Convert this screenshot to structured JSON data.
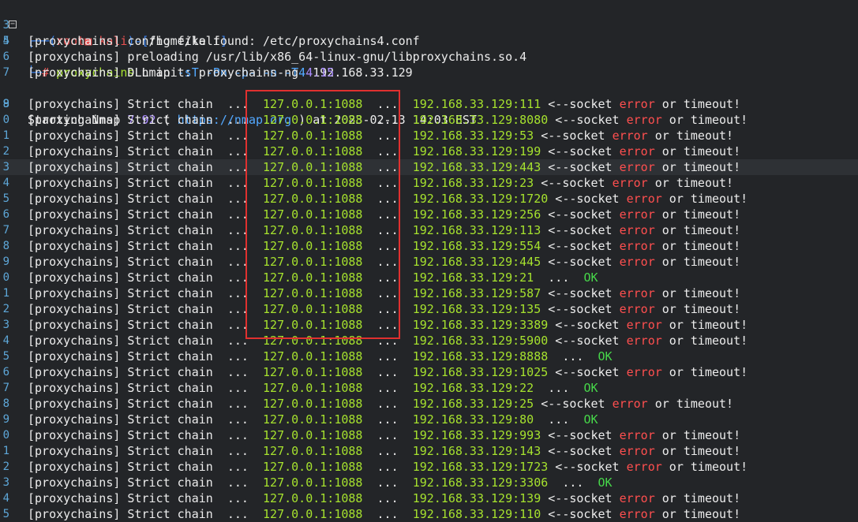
{
  "prompt": {
    "line_number": "3",
    "user": "root",
    "host": "kali",
    "skull": "■",
    "cwd": "/home/kali",
    "command_line_number": "4",
    "command": "proxychains",
    "cmd_args": "nmap",
    "flags": "-sT -Pn -p- -n -T4",
    "target": "192.168.33.129"
  },
  "header_lines": [
    {
      "n": "5",
      "prefix": "[proxychains]",
      "text": " config file found: /etc/proxychains4.conf"
    },
    {
      "n": "6",
      "prefix": "[proxychains]",
      "text": " preloading /usr/lib/x86_64-linux-gnu/libproxychains.so.4"
    },
    {
      "n": "7",
      "prefix": "[proxychains]",
      "text": " DLL init: proxychains-ng ",
      "version": "4.15"
    }
  ],
  "nmap_start": {
    "n": "8",
    "label": "Starting Nmap ",
    "version": "7.92",
    "paren_open": " ( ",
    "url": "https://nmap.org",
    "paren_close": " ) at ",
    "time": "2023-02-13 14:03 EST"
  },
  "chain": {
    "prefix": "[proxychains]",
    "mode": " Strict chain  ...  ",
    "proxy": "127.0.0.1:1088",
    "sep": "  ...  ",
    "sock": " <--socket ",
    "err": "error",
    "or": " or timeout!",
    "ok_sep": "  ...  ",
    "ok": "OK"
  },
  "chain_lines": [
    {
      "n": "9",
      "port": "192.168.33.129:111",
      "status": "error"
    },
    {
      "n": "0",
      "port": "192.168.33.129:8080",
      "status": "error"
    },
    {
      "n": "1",
      "port": "192.168.33.129:53",
      "status": "error"
    },
    {
      "n": "2",
      "port": "192.168.33.129:199",
      "status": "error"
    },
    {
      "n": "3",
      "port": "192.168.33.129:443",
      "status": "error"
    },
    {
      "n": "4",
      "port": "192.168.33.129:23",
      "status": "error"
    },
    {
      "n": "5",
      "port": "192.168.33.129:1720",
      "status": "error"
    },
    {
      "n": "6",
      "port": "192.168.33.129:256",
      "status": "error"
    },
    {
      "n": "7",
      "port": "192.168.33.129:113",
      "status": "error"
    },
    {
      "n": "8",
      "port": "192.168.33.129:554",
      "status": "error"
    },
    {
      "n": "9",
      "port": "192.168.33.129:445",
      "status": "error"
    },
    {
      "n": "0",
      "port": "192.168.33.129:21",
      "status": "ok"
    },
    {
      "n": "1",
      "port": "192.168.33.129:587",
      "status": "error"
    },
    {
      "n": "2",
      "port": "192.168.33.129:135",
      "status": "error"
    },
    {
      "n": "3",
      "port": "192.168.33.129:3389",
      "status": "error"
    },
    {
      "n": "4",
      "port": "192.168.33.129:5900",
      "status": "error"
    },
    {
      "n": "5",
      "port": "192.168.33.129:8888",
      "status": "ok"
    },
    {
      "n": "6",
      "port": "192.168.33.129:1025",
      "status": "error"
    },
    {
      "n": "7",
      "port": "192.168.33.129:22",
      "status": "ok"
    },
    {
      "n": "8",
      "port": "192.168.33.129:25",
      "status": "error"
    },
    {
      "n": "9",
      "port": "192.168.33.129:80",
      "status": "ok"
    },
    {
      "n": "0",
      "port": "192.168.33.129:993",
      "status": "error"
    },
    {
      "n": "1",
      "port": "192.168.33.129:143",
      "status": "error"
    },
    {
      "n": "2",
      "port": "192.168.33.129:1723",
      "status": "error"
    },
    {
      "n": "3",
      "port": "192.168.33.129:3306",
      "status": "ok"
    },
    {
      "n": "4",
      "port": "192.168.33.129:139",
      "status": "error"
    },
    {
      "n": "5",
      "port": "192.168.33.129:110",
      "status": "error"
    }
  ],
  "colors": {
    "background": "#232528",
    "highlight_box": "#e0302f",
    "error": "#ff4f4f",
    "ok": "#47d84a",
    "proxy": "#a6e22e",
    "port_target": "#a6e22e"
  }
}
